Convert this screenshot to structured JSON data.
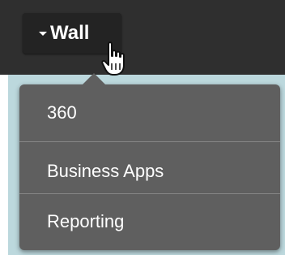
{
  "header": {
    "wall_button_label": "Wall"
  },
  "menu": {
    "items": [
      {
        "label": "360"
      },
      {
        "label": "Business Apps"
      },
      {
        "label": "Reporting"
      }
    ]
  },
  "icons": {
    "caret": "caret-down-icon",
    "cursor": "hand-pointer-cursor-icon"
  },
  "colors": {
    "topbar_bg": "#2f2f2f",
    "button_bg": "#232323",
    "menu_bg": "#5f5f5f",
    "content_bg": "#bcd8dd",
    "text": "#ffffff"
  }
}
